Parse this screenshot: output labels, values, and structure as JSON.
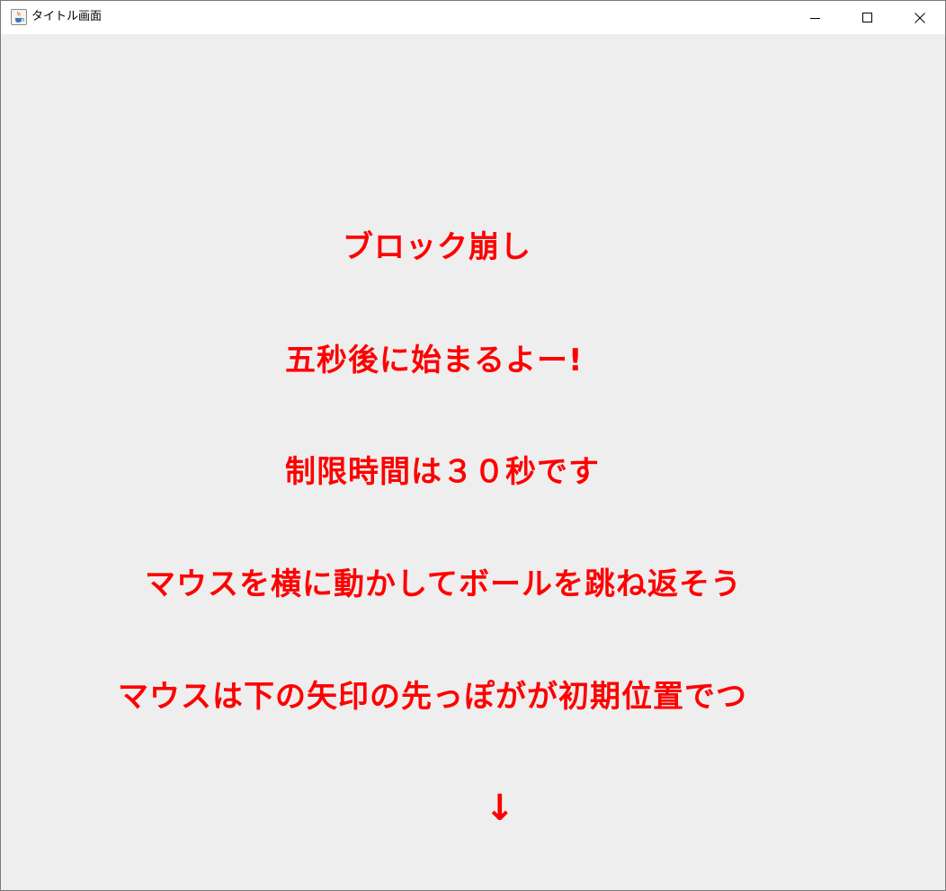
{
  "window": {
    "title": "タイトル画面",
    "icon": "java-cup-icon"
  },
  "controls": {
    "minimize_icon": "minimize-icon",
    "maximize_icon": "maximize-icon",
    "close_icon": "close-icon"
  },
  "content": {
    "background": "#eeeeee",
    "text_color": "#ff0000",
    "lines": [
      "ブロック崩し",
      "五秒後に始まるよー!",
      "制限時間は３０秒です",
      "マウスを横に動かしてボールを跳ね返そう",
      "マウスは下の矢印の先っぽがが初期位置でつ",
      "↓"
    ]
  }
}
